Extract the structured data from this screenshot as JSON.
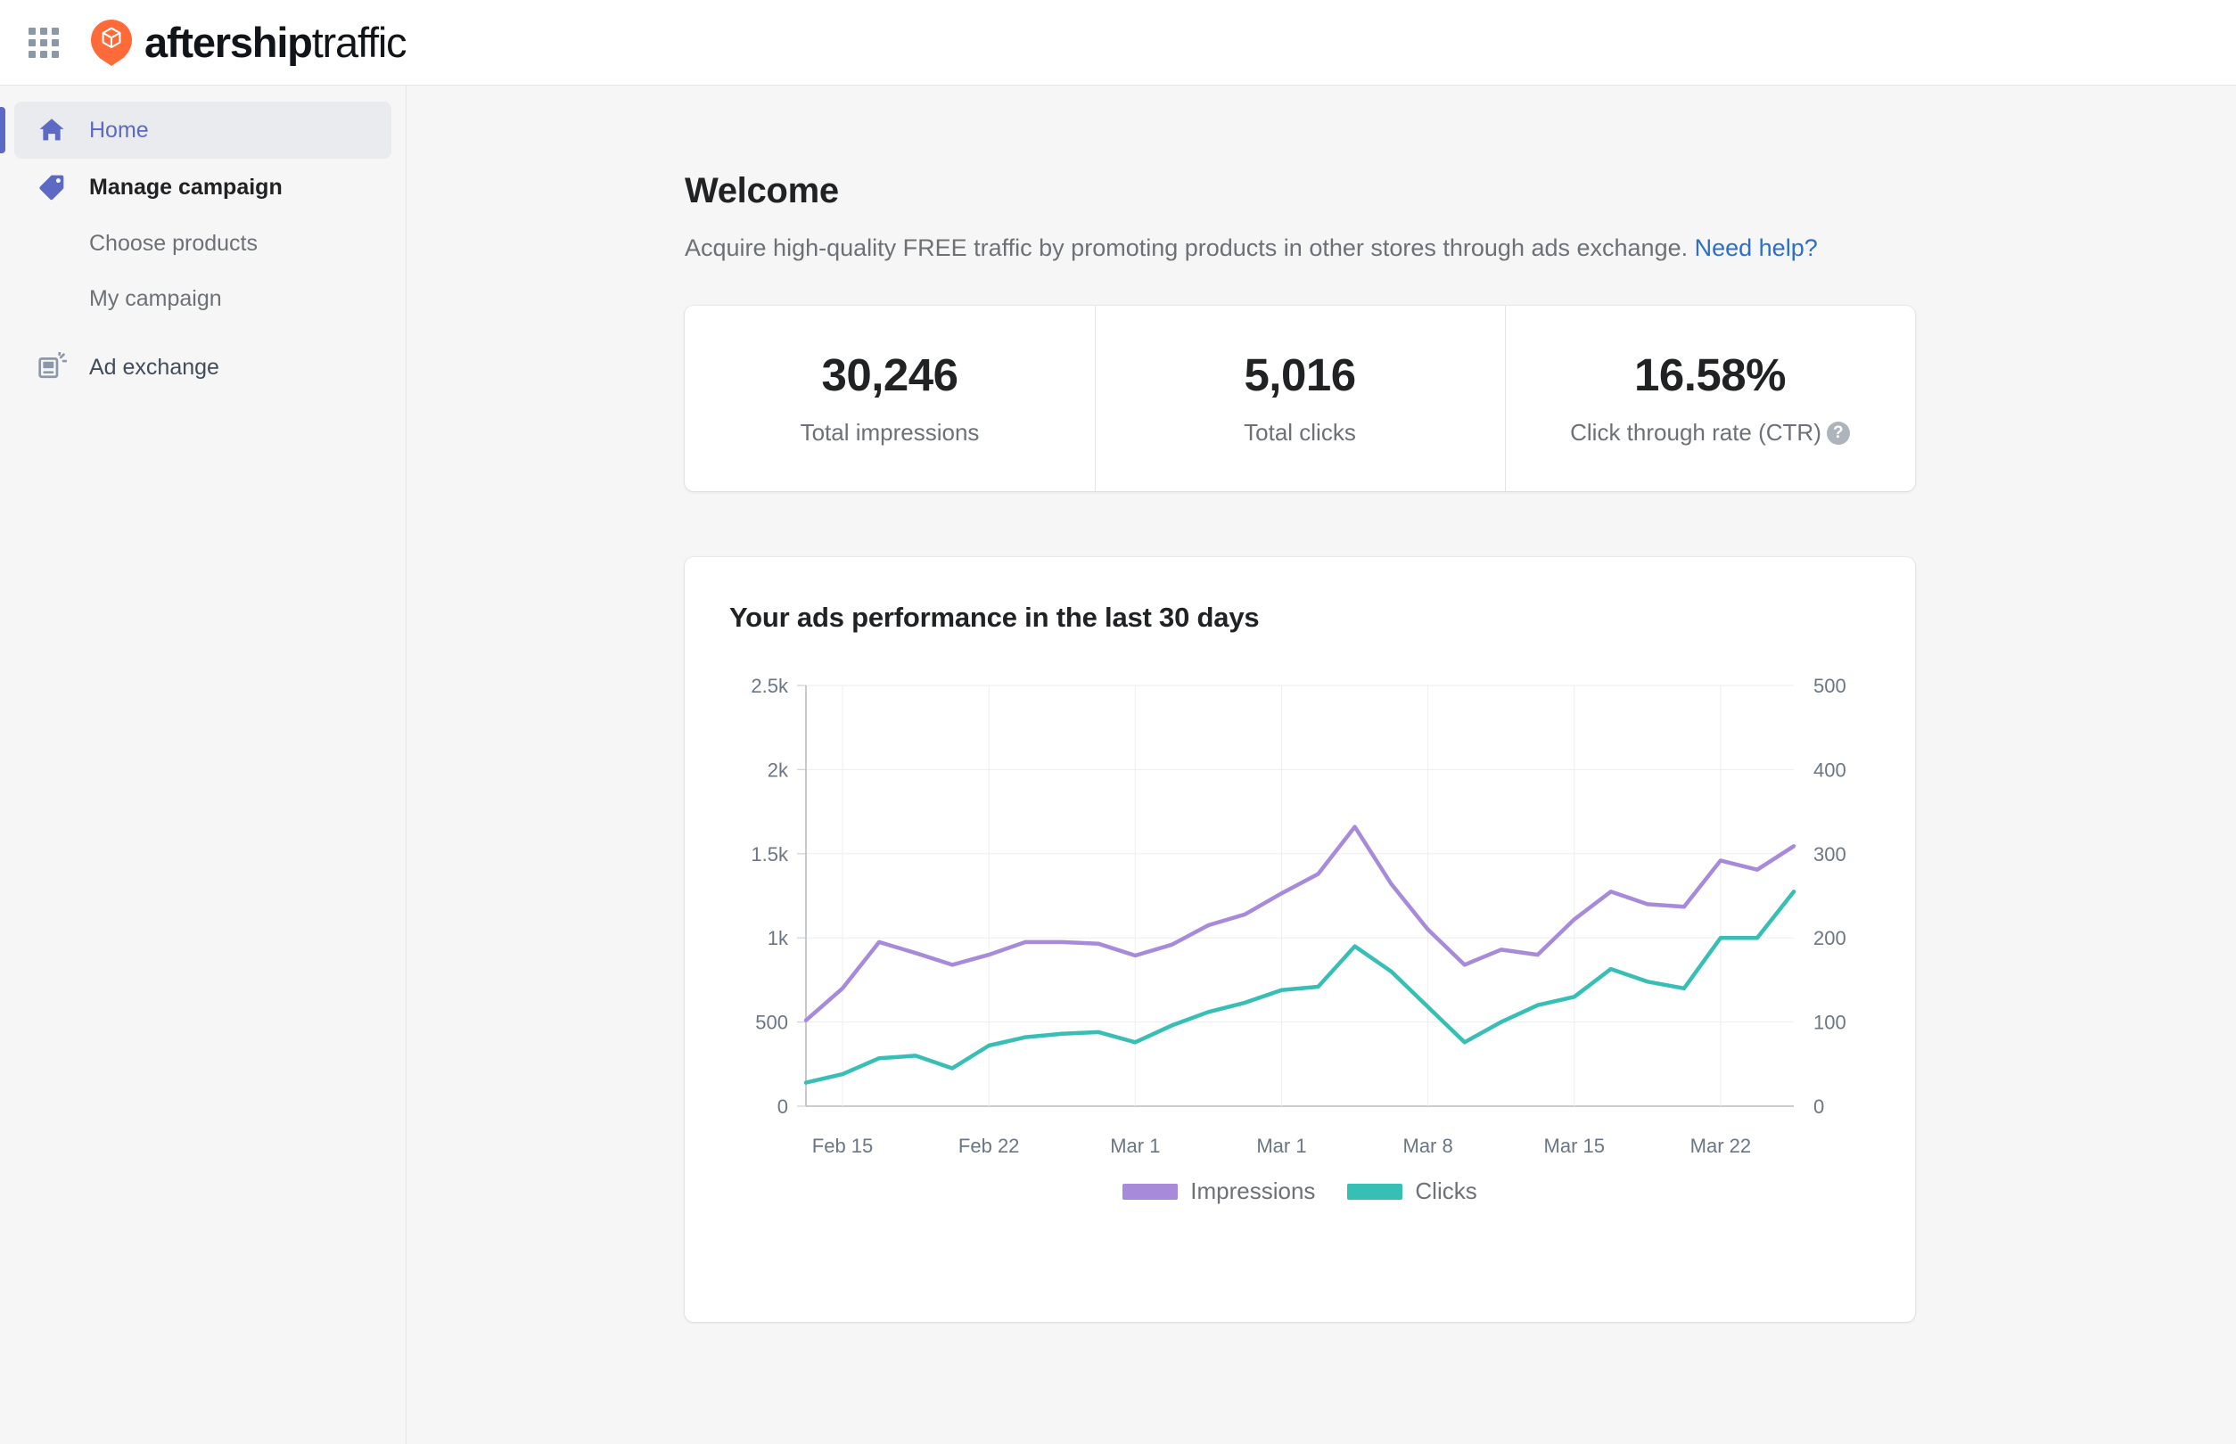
{
  "topbar": {
    "apps_icon": "grid-apps-icon",
    "brand_icon": "aftership-logo-icon",
    "brand_bold": "aftership",
    "brand_light": "traffic"
  },
  "sidebar": {
    "items": [
      {
        "label": "Home",
        "icon": "home-icon",
        "type": "item",
        "active": true
      },
      {
        "label": "Manage campaign",
        "icon": "tag-icon",
        "type": "item",
        "active": false
      },
      {
        "label": "Choose products",
        "icon": "",
        "type": "sub",
        "active": false
      },
      {
        "label": "My campaign",
        "icon": "",
        "type": "sub",
        "active": false
      },
      {
        "label": "Ad exchange",
        "icon": "ad-exchange-icon",
        "type": "item",
        "active": false
      }
    ]
  },
  "main": {
    "title": "Welcome",
    "description_before": "Acquire high-quality FREE traffic by promoting products in other stores through ads exchange. ",
    "help_link": "Need help?",
    "stats": [
      {
        "value": "30,246",
        "label": "Total impressions",
        "has_help": false
      },
      {
        "value": "5,016",
        "label": "Total clicks",
        "has_help": false
      },
      {
        "value": "16.58%",
        "label": "Click through rate (CTR)",
        "has_help": true,
        "help_glyph": "?"
      }
    ]
  },
  "chart_data": {
    "type": "line",
    "title": "Your ads performance in the last 30 days",
    "xlabel": "",
    "ylabel": "",
    "grid": true,
    "legend_position": "bottom",
    "x_ticks": [
      "Feb 15",
      "Feb 22",
      "Mar 1",
      "Mar 1",
      "Mar 8",
      "Mar 15",
      "Mar 22"
    ],
    "x_tick_indices": [
      1,
      5,
      9,
      13,
      17,
      21,
      25
    ],
    "left_axis": {
      "ticks": [
        "0",
        "500",
        "1k",
        "1.5k",
        "2k",
        "2.5k"
      ],
      "values": [
        0,
        500,
        1000,
        1500,
        2000,
        2500
      ],
      "ylim": [
        0,
        2500
      ]
    },
    "right_axis": {
      "ticks": [
        "0",
        "100",
        "200",
        "300",
        "400",
        "500"
      ],
      "values": [
        0,
        100,
        200,
        300,
        400,
        500
      ],
      "ylim": [
        0,
        500
      ]
    },
    "x": [
      0,
      1,
      2,
      3,
      4,
      5,
      6,
      7,
      8,
      9,
      10,
      11,
      12,
      13,
      14,
      15,
      16,
      17,
      18,
      19,
      20,
      21,
      22,
      23,
      24,
      25,
      26
    ],
    "series": [
      {
        "name": "Impressions",
        "color": "#a78bda",
        "axis": "left",
        "values": [
          510,
          700,
          975,
          910,
          840,
          900,
          975,
          975,
          965,
          895,
          960,
          1075,
          1140,
          1265,
          1380,
          1660,
          1320,
          1050,
          840,
          930,
          900,
          1110,
          1275,
          1200,
          1185,
          1460,
          1405,
          1545
        ]
      },
      {
        "name": "Clicks",
        "color": "#37bfb5",
        "axis": "right",
        "values": [
          28,
          38,
          57,
          60,
          45,
          72,
          82,
          86,
          88,
          76,
          96,
          112,
          123,
          138,
          142,
          190,
          160,
          118,
          76,
          100,
          120,
          130,
          163,
          148,
          140,
          200,
          200,
          255
        ]
      }
    ]
  }
}
